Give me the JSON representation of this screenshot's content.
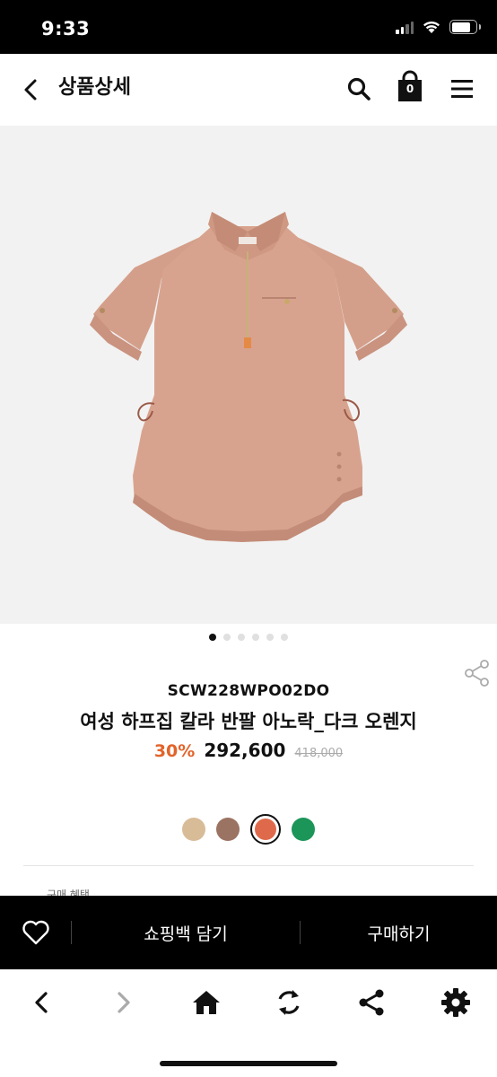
{
  "status_bar": {
    "time": "9:33"
  },
  "header": {
    "title": "상품상세",
    "bag_count": "0"
  },
  "product": {
    "code": "SCW228WPO02DO",
    "name": "여성 하프집 칼라 반팔 아노락_다크 오렌지",
    "discount": "30%",
    "price": "292,600",
    "original_price": "418,000",
    "image_color": "#d9a590"
  },
  "carousel": {
    "count": 6,
    "active": 0
  },
  "swatches": [
    {
      "name": "beige",
      "color": "#d8bc98"
    },
    {
      "name": "brown",
      "color": "#9b7363"
    },
    {
      "name": "dark-orange",
      "color": "#df6a4b",
      "selected": true
    },
    {
      "name": "green",
      "color": "#1c9558"
    }
  ],
  "peek_text": "구매 혜택",
  "action_bar": {
    "cart_label": "쇼핑백 담기",
    "buy_label": "구매하기"
  },
  "colors": {
    "accent": "#e2642b",
    "bar_bg": "#000000"
  }
}
